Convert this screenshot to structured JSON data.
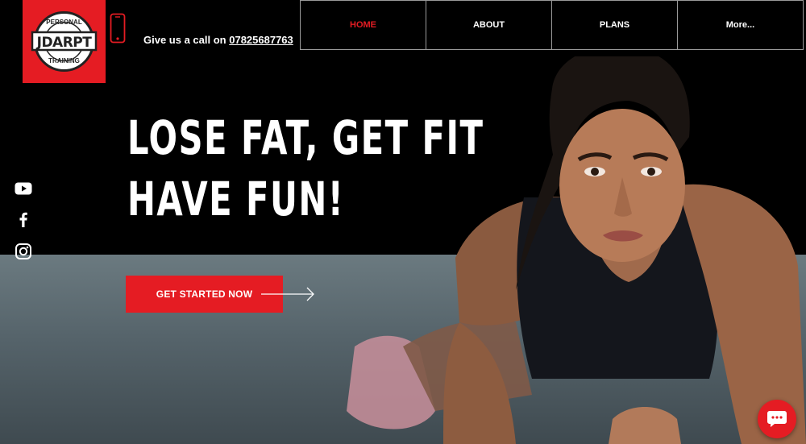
{
  "brand": {
    "logo_text": "JDARPT",
    "logo_top_text": "PERSONAL",
    "logo_bottom_text": "TRAINING",
    "accent_color": "#e51c23"
  },
  "contact": {
    "call_label": "Give us a call on",
    "phone_number": "07825687763"
  },
  "nav": {
    "items": [
      {
        "label": "HOME",
        "active": true
      },
      {
        "label": "ABOUT",
        "active": false
      },
      {
        "label": "PLANS",
        "active": false
      },
      {
        "label": "More...",
        "active": false
      }
    ]
  },
  "hero": {
    "headline_line1": "LOSE FAT, GET FIT",
    "headline_line2": "HAVE FUN!",
    "cta_label": "GET STARTED NOW"
  },
  "social": {
    "icons": [
      "youtube-icon",
      "facebook-icon",
      "instagram-icon"
    ]
  },
  "chat": {
    "icon": "chat-bubble-icon"
  }
}
